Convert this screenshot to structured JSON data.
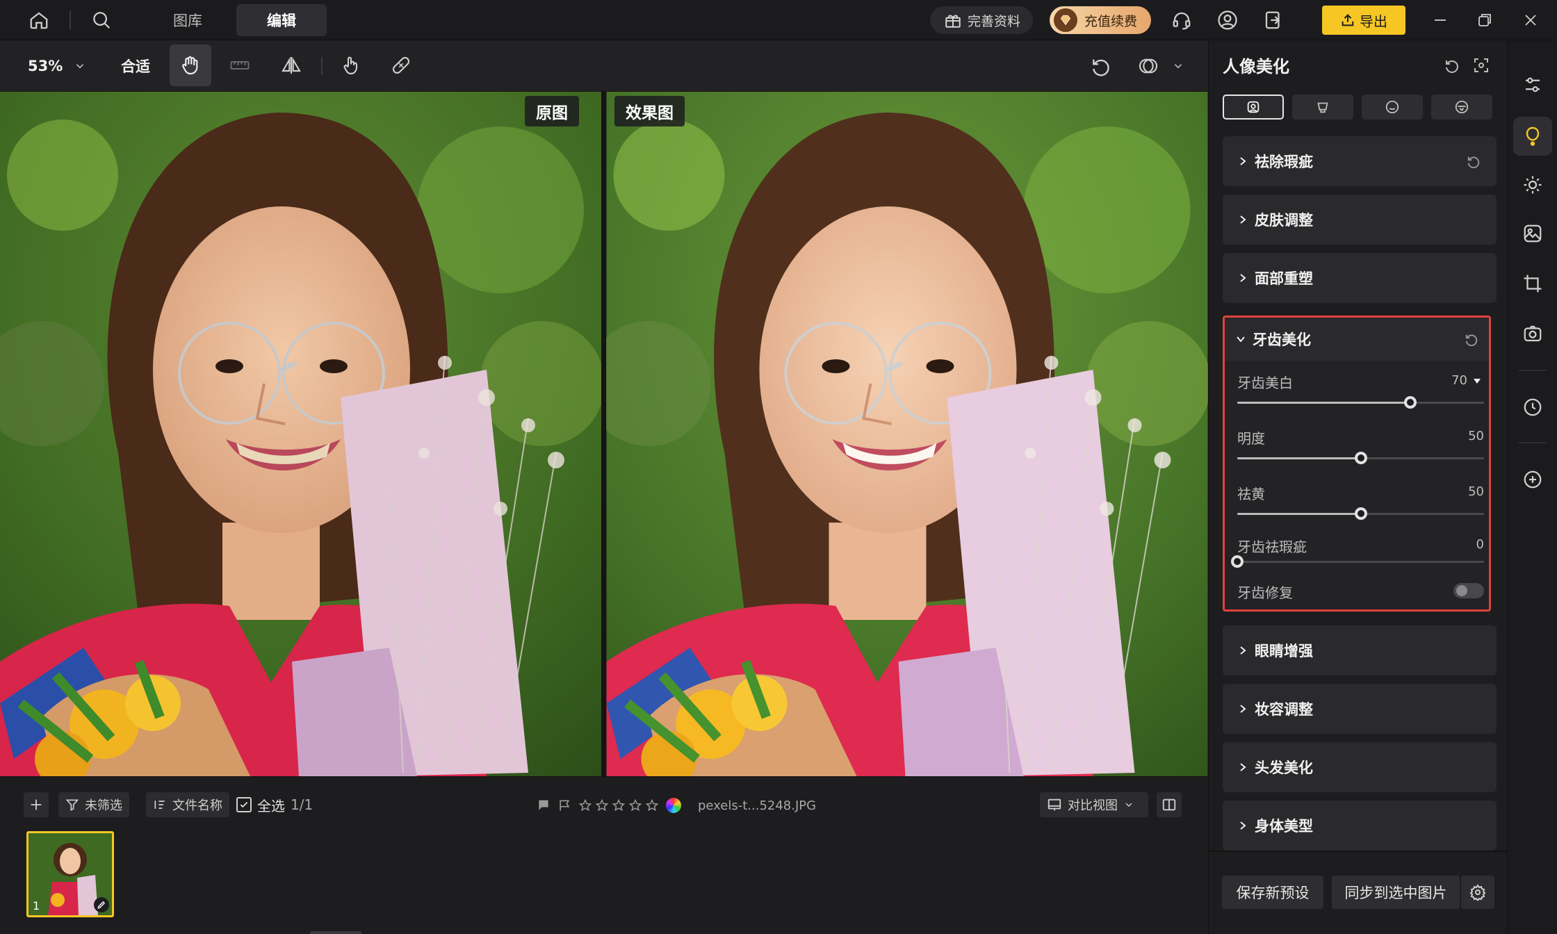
{
  "nav": {
    "tabs": [
      {
        "label": "图库"
      },
      {
        "label": "编辑"
      }
    ],
    "profile_label": "完善资料",
    "recharge_label": "充值续费",
    "export_label": "导出"
  },
  "toolbar": {
    "zoom": "53%",
    "fit_label": "合适"
  },
  "canvas": {
    "original_label": "原图",
    "result_label": "效果图"
  },
  "filmstrip": {
    "filter_label": "未筛选",
    "sort_label": "文件名称",
    "select_all_label": "全选",
    "count": "1/1",
    "rating": 0,
    "filename": "pexels-t...5248.JPG",
    "compare_view_label": "对比视图",
    "thumb_index": "1"
  },
  "panel": {
    "title": "人像美化",
    "sections": [
      {
        "label": "祛除瑕疵"
      },
      {
        "label": "皮肤调整"
      },
      {
        "label": "面部重塑"
      },
      {
        "label": "牙齿美化"
      },
      {
        "label": "眼睛增强"
      },
      {
        "label": "妆容调整"
      },
      {
        "label": "头发美化"
      },
      {
        "label": "身体美型"
      }
    ],
    "teeth": {
      "whiten": {
        "label": "牙齿美白",
        "value": "70"
      },
      "brightness": {
        "label": "明度",
        "value": "50"
      },
      "yellow": {
        "label": "祛黄",
        "value": "50"
      },
      "blemish": {
        "label": "牙齿祛瑕疵",
        "value": "0"
      },
      "repair": {
        "label": "牙齿修复",
        "enabled": false
      }
    },
    "save_preset_label": "保存新预设",
    "sync_label": "同步到选中图片"
  },
  "colors": {
    "accent_yellow": "#f6c624",
    "highlight_red": "#e0433c",
    "panel_bg": "#1d1d1f"
  }
}
